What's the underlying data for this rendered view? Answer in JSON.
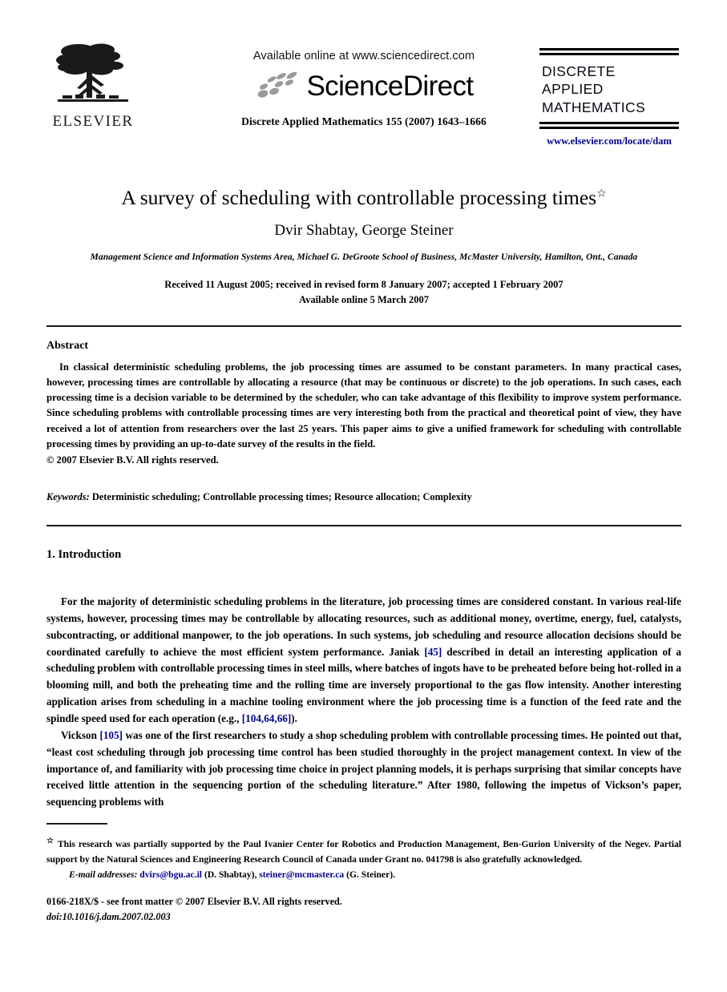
{
  "masthead": {
    "publisher_name": "ELSEVIER",
    "publisher_logo_icon": "elsevier-tree-logo",
    "available_online": "Available online at www.sciencedirect.com",
    "sciencedirect_wordmark": "ScienceDirect",
    "sciencedirect_swoosh_icon": "sciencedirect-swoosh-icon",
    "journal_reference": "Discrete Applied Mathematics 155 (2007) 1643–1666",
    "journal_logo": {
      "line1": "DISCRETE",
      "line2": "APPLIED",
      "line3": "MATHEMATICS",
      "url": "www.elsevier.com/locate/dam",
      "url_color": "#00008b"
    }
  },
  "article": {
    "title": "A survey of scheduling with controllable processing times",
    "title_footnote_marker": "☆",
    "authors": "Dvir Shabtay, George Steiner",
    "affiliation": "Management Science and Information Systems Area, Michael G. DeGroote School of Business, McMaster University, Hamilton, Ont., Canada",
    "history_line1": "Received 11 August 2005; received in revised form 8 January 2007; accepted 1 February 2007",
    "history_line2": "Available online 5 March 2007"
  },
  "abstract": {
    "heading": "Abstract",
    "body": "In classical deterministic scheduling problems, the job processing times are assumed to be constant parameters. In many practical cases, however, processing times are controllable by allocating a resource (that may be continuous or discrete) to the job operations. In such cases, each processing time is a decision variable to be determined by the scheduler, who can take advantage of this flexibility to improve system performance. Since scheduling problems with controllable processing times are very interesting both from the practical and theoretical point of view, they have received a lot of attention from researchers over the last 25 years. This paper aims to give a unified framework for scheduling with controllable processing times by providing an up-to-date survey of the results in the field.",
    "copyright": "© 2007 Elsevier B.V. All rights reserved.",
    "keywords_label": "Keywords:",
    "keywords_value": "Deterministic scheduling; Controllable processing times; Resource allocation; Complexity"
  },
  "introduction": {
    "heading": "1. Introduction",
    "paragraph1_part1": "For the majority of deterministic scheduling problems in the literature, job processing times are considered constant. In various real-life systems, however, processing times may be controllable by allocating resources, such as additional money, overtime, energy, fuel, catalysts, subcontracting, or additional manpower, to the job operations. In such systems, job scheduling and resource allocation decisions should be coordinated carefully to achieve the most efficient system performance. Janiak ",
    "paragraph1_cite1": "[45]",
    "paragraph1_part2": " described in detail an interesting application of a scheduling problem with controllable processing times in steel mills, where batches of ingots have to be preheated before being hot-rolled in a blooming mill, and both the preheating time and the rolling time are inversely proportional to the gas flow intensity. Another interesting application arises from scheduling in a machine tooling environment where the job processing time is a function of the feed rate and the spindle speed used for each operation (e.g., ",
    "paragraph1_cite2": "[104,64,66]",
    "paragraph1_part3": ").",
    "paragraph2_part1": "Vickson ",
    "paragraph2_cite1": "[105]",
    "paragraph2_part2": " was one of the first researchers to study a shop scheduling problem with controllable processing times. He pointed out that, “least cost scheduling through job processing time control has been studied thoroughly in the project management context. In view of the importance of, and familiarity with job processing time choice in project planning models, it is perhaps surprising that similar concepts have received little attention in the sequencing portion of the scheduling literature.” After 1980, following the impetus of Vickson’s paper, sequencing problems with",
    "cite_color": "#00008b"
  },
  "footnote": {
    "marker": "☆",
    "text": "This research was partially supported by the Paul Ivanier Center for Robotics and Production Management, Ben-Gurion University of the Negev. Partial support by the Natural Sciences and Engineering Research Council of Canada under Grant no. 041798 is also gratefully acknowledged.",
    "email_label": "E-mail addresses:",
    "email1": "dvirs@bgu.ac.il",
    "email1_owner": "(D. Shabtay),",
    "email2": "steiner@mcmaster.ca",
    "email2_owner": "(G. Steiner)."
  },
  "imprint": {
    "front_matter": "0166-218X/$ - see front matter © 2007 Elsevier B.V. All rights reserved.",
    "doi": "doi:10.1016/j.dam.2007.02.003"
  }
}
